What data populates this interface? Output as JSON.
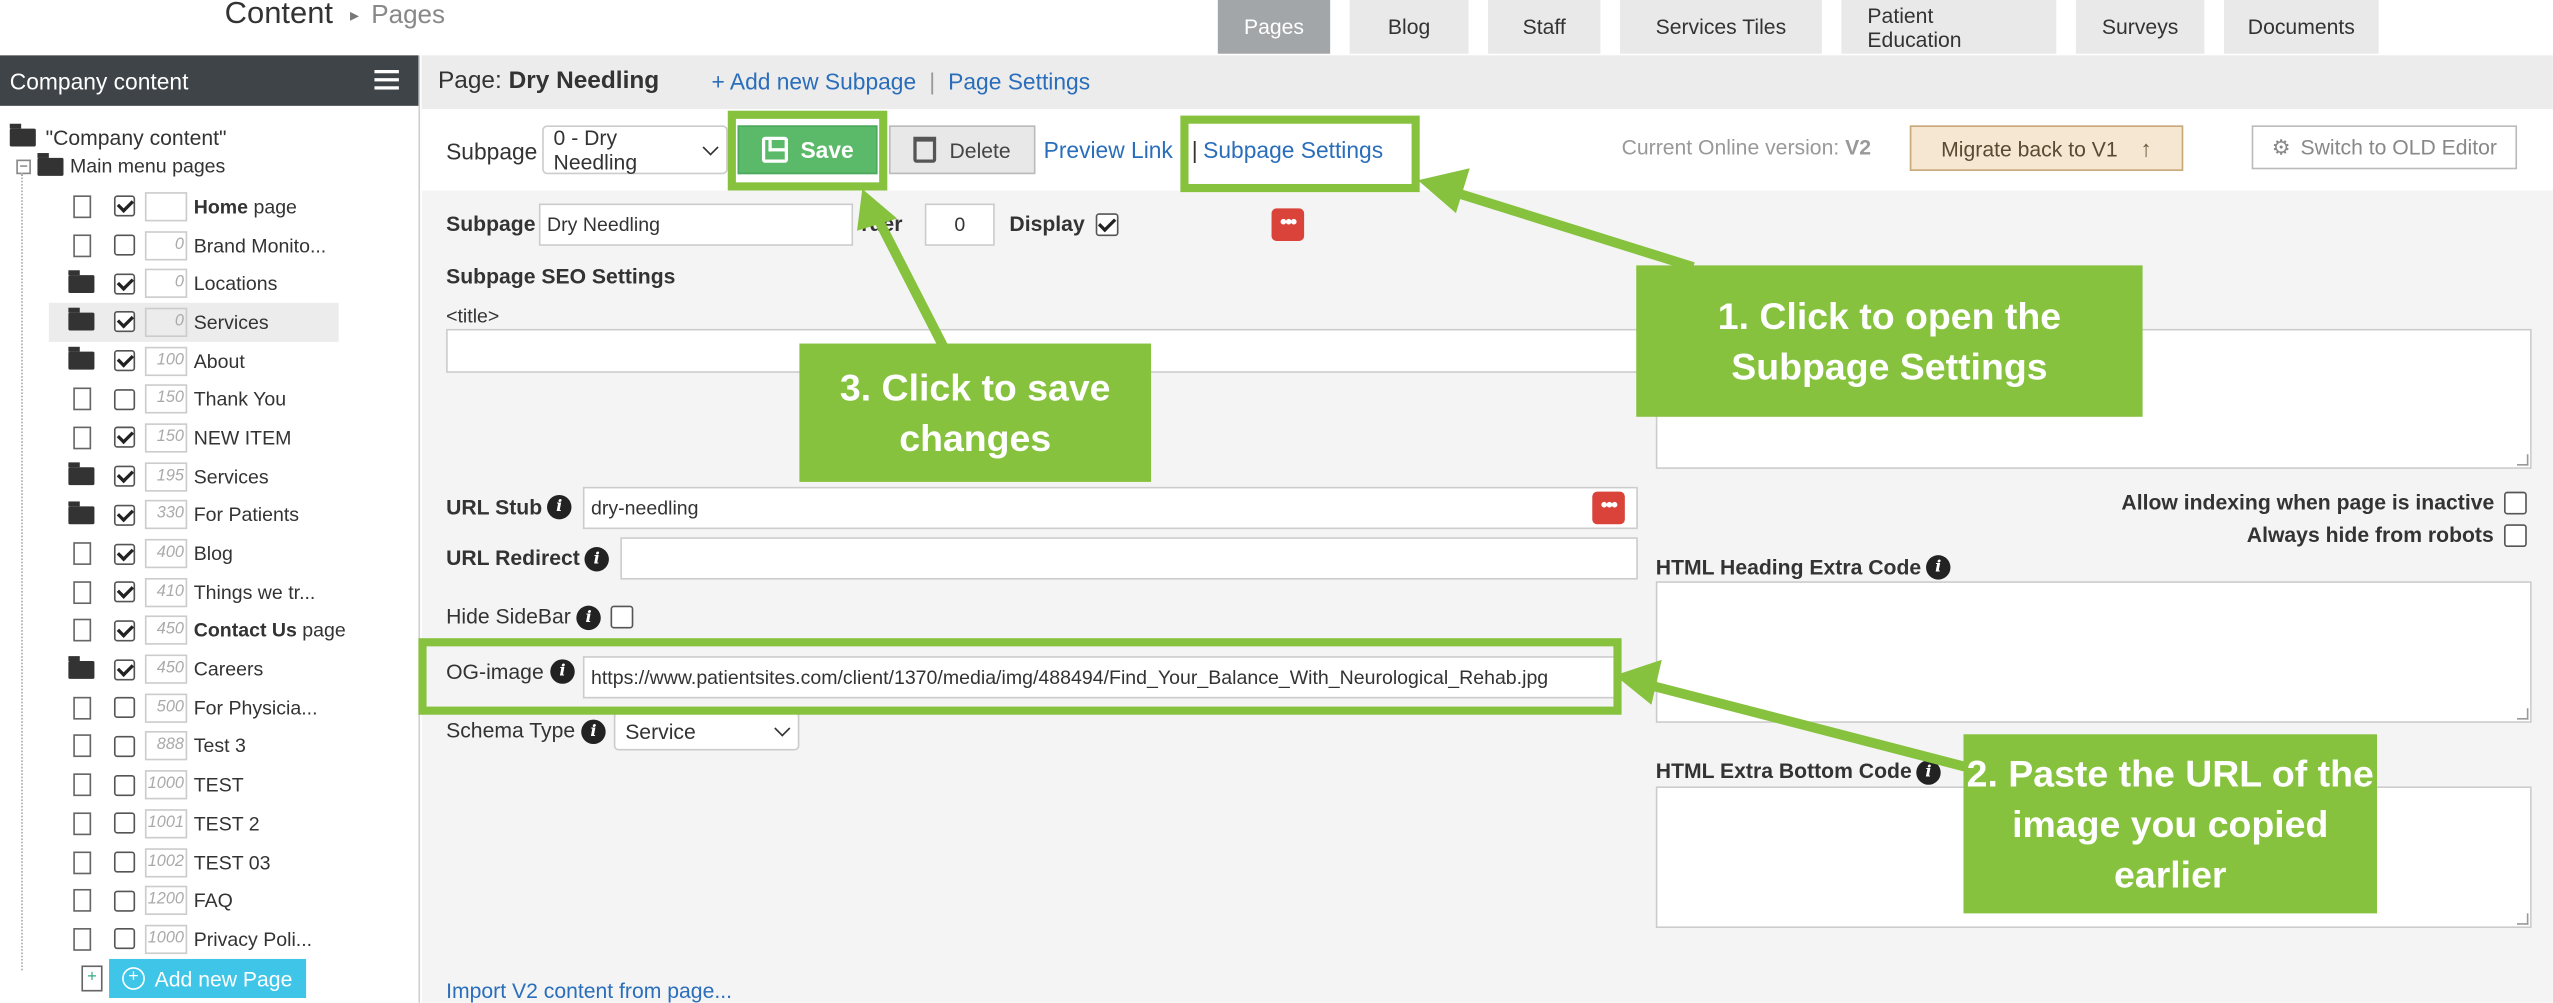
{
  "header": {
    "breadcrumb_main": "Content",
    "breadcrumb_arrow": "▸",
    "breadcrumb_sub": "Pages",
    "tabs": [
      {
        "label": "Pages",
        "active": true
      },
      {
        "label": "Blog"
      },
      {
        "label": "Staff"
      },
      {
        "label": "Services Tiles"
      },
      {
        "label": "Patient Education"
      },
      {
        "label": "Surveys"
      },
      {
        "label": "Documents"
      }
    ]
  },
  "sidebar": {
    "title": "Company content",
    "root_label": "\"Company content\"",
    "main_menu_label": "Main menu pages",
    "items": [
      {
        "order": "",
        "prefix": "Home",
        "suffix": " page",
        "bold": true,
        "checked": true,
        "type": "doc"
      },
      {
        "order": "0",
        "label": "Brand Monito...",
        "checked": false,
        "type": "doc"
      },
      {
        "order": "0",
        "label": "Locations",
        "checked": true,
        "type": "folder"
      },
      {
        "order": "0",
        "label": "Services",
        "checked": true,
        "type": "folder",
        "selected": true
      },
      {
        "order": "100",
        "label": "About",
        "checked": true,
        "type": "folder"
      },
      {
        "order": "150",
        "label": "Thank You",
        "checked": false,
        "type": "doc"
      },
      {
        "order": "150",
        "label": "NEW ITEM",
        "checked": true,
        "type": "doc"
      },
      {
        "order": "195",
        "label": "Services",
        "checked": true,
        "type": "folder"
      },
      {
        "order": "330",
        "label": "For Patients",
        "checked": true,
        "type": "folder"
      },
      {
        "order": "400",
        "label": "Blog",
        "checked": true,
        "type": "doc"
      },
      {
        "order": "410",
        "label": "Things we tr...",
        "checked": true,
        "type": "doc"
      },
      {
        "order": "450",
        "prefix": "Contact Us",
        "suffix": " page",
        "bold": true,
        "checked": true,
        "type": "doc"
      },
      {
        "order": "450",
        "label": "Careers",
        "checked": true,
        "type": "folder"
      },
      {
        "order": "500",
        "label": "For Physicia...",
        "checked": false,
        "type": "doc"
      },
      {
        "order": "888",
        "label": "Test 3",
        "checked": false,
        "type": "doc"
      },
      {
        "order": "1000",
        "label": "TEST",
        "checked": false,
        "type": "doc"
      },
      {
        "order": "1001",
        "label": "TEST 2",
        "checked": false,
        "type": "doc"
      },
      {
        "order": "1002",
        "label": "TEST 03",
        "checked": false,
        "type": "doc"
      },
      {
        "order": "1200",
        "label": "FAQ",
        "checked": false,
        "type": "doc"
      },
      {
        "order": "1000",
        "label": "Privacy Poli...",
        "checked": false,
        "type": "doc"
      }
    ],
    "add_page_label": "Add new Page"
  },
  "page_bar": {
    "prefix": "Page: ",
    "page_name": "Dry Needling",
    "add_subpage": "+ Add new Subpage",
    "separator": "|",
    "page_settings": "Page Settings"
  },
  "toolbar": {
    "subpage_label": "Subpage",
    "subpage_select": "0 - Dry Needling",
    "save_label": "Save",
    "delete_label": "Delete",
    "preview_link": "Preview Link",
    "pipe": "|",
    "subpage_settings": "Subpage Settings",
    "online_version_label": "Current Online version: ",
    "online_version_value": "V2",
    "migrate_label": "Migrate back to V1",
    "migrate_arrow": "↑",
    "switch_old_label": "Switch to OLD Editor"
  },
  "form": {
    "subpage_label": "Subpage",
    "subpage_value": "Dry Needling",
    "order_label": "Order",
    "order_visible": "rder",
    "order_value": "0",
    "display_label": "Display",
    "seo_heading": "Subpage SEO Settings",
    "title_tag_label": "<title>",
    "url_stub_label": "URL Stub",
    "url_stub_value": "dry-needling",
    "url_redirect_label": "URL Redirect",
    "url_redirect_value": "",
    "hide_sidebar_label": "Hide SideBar",
    "og_image_label": "OG-image",
    "og_image_value": "https://www.patientsites.com/client/1370/media/img/488494/Find_Your_Balance_With_Neurological_Rehab.jpg",
    "schema_type_label": "Schema Type",
    "schema_type_value": "Service",
    "allow_indexing_label": "Allow indexing when page is inactive",
    "always_hide_label": "Always hide from robots",
    "html_heading_label": "HTML Heading Extra Code",
    "html_bottom_label": "HTML Extra Bottom Code",
    "import_link": "Import V2 content from page...",
    "info_glyph": "i",
    "dots_glyph": "•••"
  },
  "annotations": {
    "callout_1": "1. Click to open the Subpage Settings",
    "callout_2": "2. Paste the URL of the image you copied earlier",
    "callout_3": "3. Click to save changes",
    "accent_color": "#86c23e"
  }
}
